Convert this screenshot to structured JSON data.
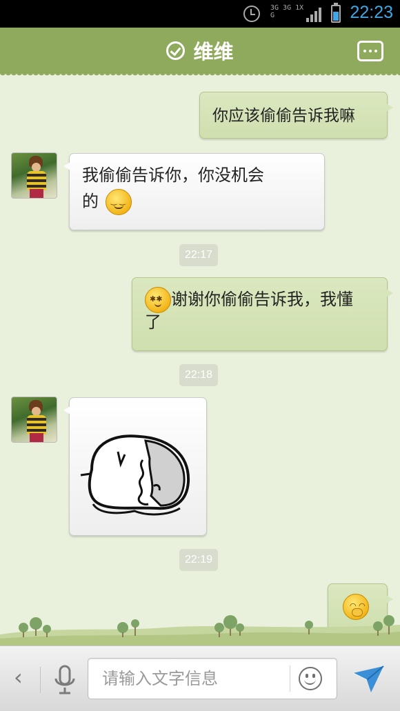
{
  "status_bar": {
    "time": "22:23",
    "network_label": "3G 3G 1X G",
    "icons": [
      "alarm-icon",
      "network-type-icon",
      "signal-icon",
      "battery-icon"
    ]
  },
  "header": {
    "title": "维维",
    "status_icon": "check-circle-icon",
    "menu_icon": "more-icon",
    "background_color": "#8faa5d"
  },
  "messages": [
    {
      "direction": "outgoing",
      "text": "你应该偷偷告诉我嘛"
    },
    {
      "direction": "incoming",
      "text_line1": "我偷偷告诉你，你没机会",
      "text_line2": "的",
      "emoji": "smile-emoji"
    },
    {
      "type": "timestamp",
      "text": "22:17"
    },
    {
      "direction": "outgoing",
      "emoji": "dizzy-emoji",
      "text_line1": "谢谢你偷偷告诉我，我懂",
      "text_line2": "了"
    },
    {
      "type": "timestamp",
      "text": "22:18"
    },
    {
      "direction": "incoming",
      "content": "sticker-image"
    },
    {
      "type": "timestamp",
      "text": "22:19"
    },
    {
      "direction": "outgoing",
      "emoji": "shy-emoji"
    }
  ],
  "input_bar": {
    "placeholder": "请输入文字信息",
    "value": "",
    "icons": [
      "back-arrow-icon",
      "microphone-icon",
      "emoji-picker-icon",
      "send-icon"
    ]
  },
  "colors": {
    "chat_background": "#e9f0dc",
    "outgoing_bubble": "#d3e2b4",
    "incoming_bubble": "#f6f6f6",
    "timestamp_badge": "#d7dccd",
    "status_time": "#3ea7e5"
  }
}
